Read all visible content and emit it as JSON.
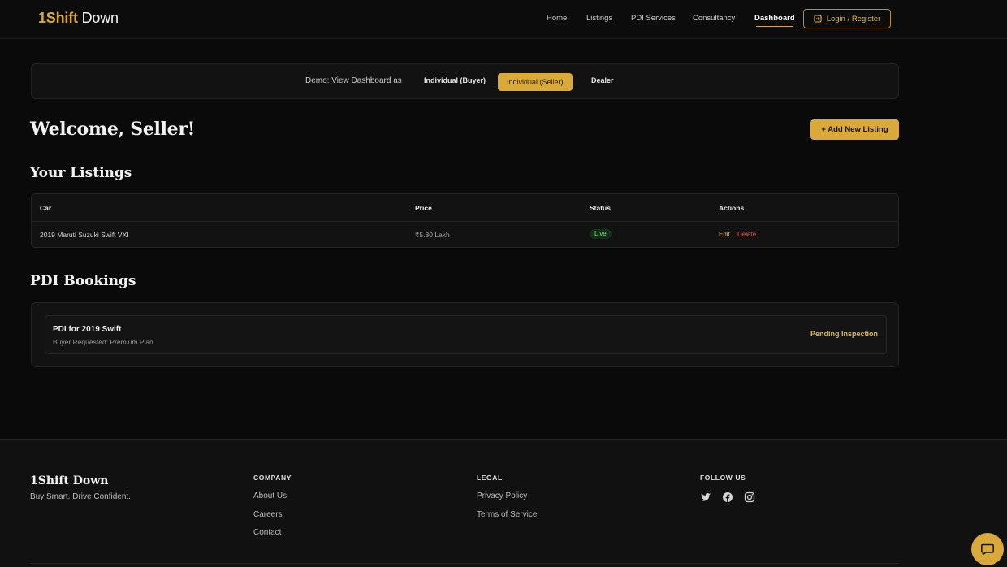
{
  "header": {
    "logo_prefix": "1Shift",
    "logo_suffix": " Down",
    "nav": [
      {
        "label": "Home"
      },
      {
        "label": "Listings"
      },
      {
        "label": "PDI Services"
      },
      {
        "label": "Consultancy"
      },
      {
        "label": "Dashboard",
        "active": true
      }
    ],
    "login_label": "Login / Register",
    "login_icon": "sign-in-icon"
  },
  "demo": {
    "label": "Demo: View Dashboard as",
    "options": [
      "Individual (Buyer)",
      "Individual (Seller)",
      "Dealer"
    ],
    "selected": "Individual (Seller)"
  },
  "welcome": {
    "title": "Welcome, Seller!",
    "add_listing_label": "+ Add New Listing"
  },
  "listings": {
    "title": "Your Listings",
    "columns": [
      "Car",
      "Price",
      "Status",
      "Actions"
    ],
    "rows": [
      {
        "car": "2019 Maruti Suzuki Swift VXI",
        "price": "₹5.80 Lakh",
        "status": "Live",
        "edit": "Edit",
        "delete": "Delete"
      }
    ]
  },
  "pdi": {
    "title": "PDI Bookings",
    "items": [
      {
        "title": "PDI for 2019 Swift",
        "subtitle": "Buyer Requested: Premium Plan",
        "status": "Pending Inspection"
      }
    ]
  },
  "footer": {
    "brand": "1Shift Down",
    "tagline": "Buy Smart. Drive Confident.",
    "company": {
      "heading": "COMPANY",
      "links": [
        "About Us",
        "Careers",
        "Contact"
      ]
    },
    "legal": {
      "heading": "LEGAL",
      "links": [
        "Privacy Policy",
        "Terms of Service"
      ]
    },
    "follow": {
      "heading": "FOLLOW US",
      "icons": [
        "twitter-icon",
        "facebook-icon",
        "instagram-icon"
      ]
    }
  },
  "chat": {
    "icon": "chat-icon"
  },
  "colors": {
    "accent": "#d9aa3a",
    "live": "#6ee07a",
    "danger": "#e0584c",
    "background": "#0a0a0a"
  }
}
